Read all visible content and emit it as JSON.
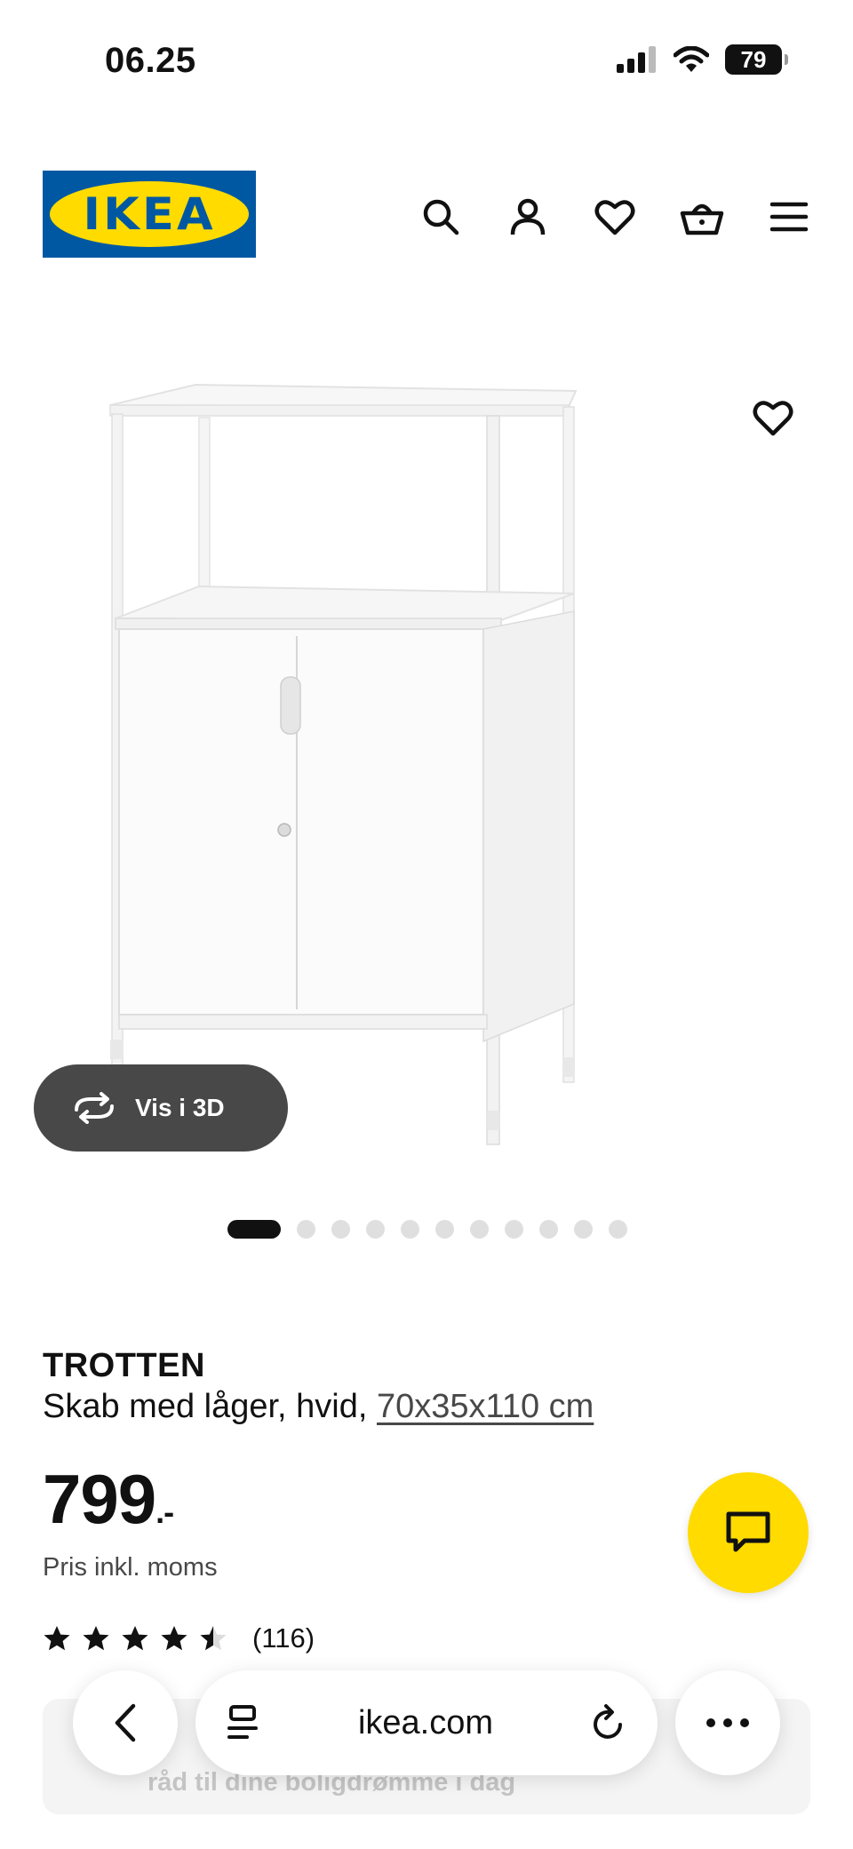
{
  "status_bar": {
    "time": "06.25",
    "battery": "79"
  },
  "header": {
    "logo_text": "IKEA",
    "icons": [
      "search-icon",
      "account-icon",
      "heart-icon",
      "basket-icon",
      "menu-icon"
    ]
  },
  "gallery": {
    "view_3d_label": "Vis i 3D",
    "dot_count": 11,
    "active_dot": 1
  },
  "product": {
    "name": "TROTTEN",
    "description": "Skab med låger, hvid, ",
    "size": "70x35x110 cm",
    "price": "799",
    "price_suffix": ".-",
    "price_note": "Pris inkl. moms",
    "rating": 4.5,
    "rating_max": 5,
    "review_count": "(116)"
  },
  "behind_bar_text": "råd til dine boligdrømme i dag",
  "browser": {
    "url": "ikea.com"
  },
  "colors": {
    "ikea_blue": "#0058a3",
    "ikea_yellow": "#ffdb00",
    "dark_pill": "#484848"
  }
}
